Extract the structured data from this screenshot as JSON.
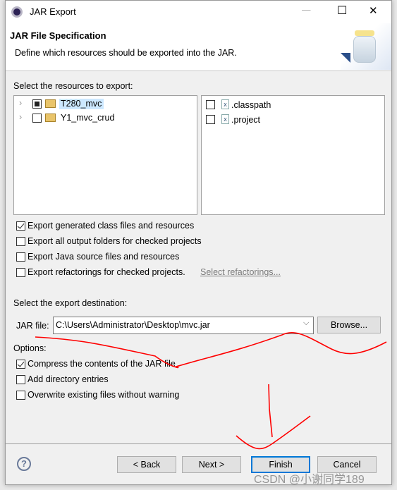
{
  "window": {
    "title": "JAR Export",
    "minimize": "—",
    "maximize": "☐",
    "close": "✕"
  },
  "header": {
    "title": "JAR File Specification",
    "description": "Define which resources should be exported into the JAR."
  },
  "resources": {
    "label": "Select the resources to export:",
    "tree": [
      {
        "name": "T280_mvc",
        "state": "partial",
        "selected": true
      },
      {
        "name": "Y1_mvc_crud",
        "state": "unchecked",
        "selected": false
      }
    ],
    "files": [
      {
        "name": ".classpath",
        "checked": false
      },
      {
        "name": ".project",
        "checked": false
      }
    ]
  },
  "export_options": [
    {
      "label": "Export generated class files and resources",
      "checked": true
    },
    {
      "label": "Export all output folders for checked projects",
      "checked": false
    },
    {
      "label": "Export Java source files and resources",
      "checked": false
    },
    {
      "label": "Export refactorings for checked projects.",
      "checked": false
    }
  ],
  "select_refactorings_link": "Select refactorings...",
  "destination": {
    "label": "Select the export destination:",
    "jar_label": "JAR file:",
    "jar_value": "C:\\Users\\Administrator\\Desktop\\mvc.jar",
    "browse": "Browse..."
  },
  "options": {
    "label": "Options:",
    "items": [
      {
        "label": "Compress the contents of the JAR file",
        "checked": true
      },
      {
        "label": "Add directory entries",
        "checked": false
      },
      {
        "label": "Overwrite existing files without warning",
        "checked": false
      }
    ]
  },
  "buttons": {
    "back": "< Back",
    "next": "Next >",
    "finish": "Finish",
    "cancel": "Cancel",
    "help": "?"
  },
  "watermark": "CSDN @小谢同学189",
  "colors": {
    "selection": "#cce8ff",
    "link": "#7a7a7a",
    "focus": "#0078d7",
    "annotation": "#ff0000"
  }
}
